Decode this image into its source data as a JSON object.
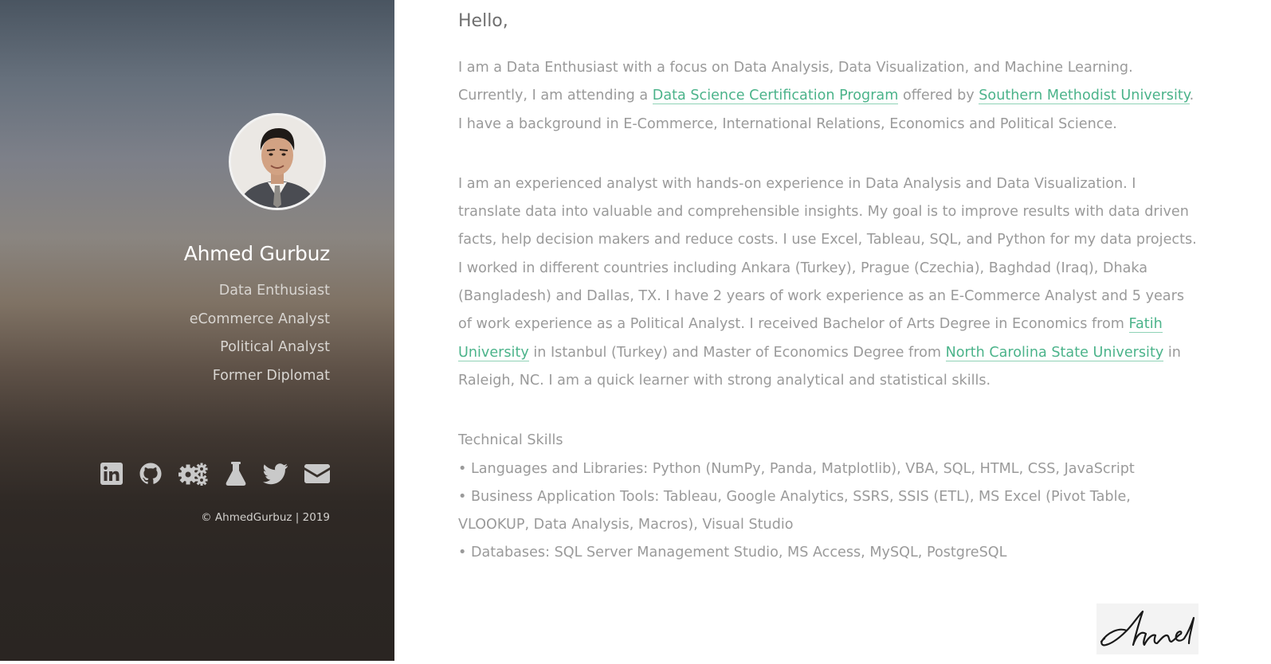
{
  "sidebar": {
    "name": "Ahmed Gurbuz",
    "roles": [
      "Data Enthusiast",
      "eCommerce Analyst",
      "Political Analyst",
      "Former Diplomat"
    ],
    "social": [
      {
        "icon": "linkedin-icon"
      },
      {
        "icon": "github-icon"
      },
      {
        "icon": "gears-icon"
      },
      {
        "icon": "flask-icon"
      },
      {
        "icon": "twitter-icon"
      },
      {
        "icon": "envelope-icon"
      }
    ],
    "copyright": "© AhmedGurbuz | 2019"
  },
  "main": {
    "greeting": "Hello,",
    "intro": {
      "line1": "I am a Data Enthusiast with a focus on Data Analysis, Data Visualization, and Machine Learning.",
      "line2_before": "Currently, I am attending a ",
      "link_program": "Data Science Certification Program",
      "line2_mid": " offered by ",
      "link_smu": "Southern Methodist University",
      "line2_after": ". I have a background in E-Commerce, International Relations, Economics and Political Science."
    },
    "experience": {
      "text_before": "I am an experienced analyst with hands-on experience in Data Analysis and Data Visualization. I translate data into valuable and comprehensible insights. My goal is to improve results with data driven facts, help decision makers and reduce costs. I use Excel, Tableau, SQL, and Python for my data projects. I worked in different countries including Ankara (Turkey), Prague (Czechia), Baghdad (Iraq), Dhaka (Bangladesh) and Dallas, TX. I have 2 years of work experience as an E-Commerce Analyst and 5 years of work experience as a Political Analyst. I received Bachelor of Arts Degree in Economics from ",
      "link_fatih": "Fatih University",
      "text_mid": " in Istanbul (Turkey) and Master of Economics Degree from ",
      "link_ncsu": "North Carolina State University",
      "text_after": " in Raleigh, NC. I am a quick learner with strong analytical and statistical skills."
    },
    "skills": {
      "heading": "Technical Skills",
      "items": [
        "• Languages and Libraries: Python (NumPy, Panda, Matplotlib), VBA, SQL, HTML, CSS, JavaScript",
        "• Business Application Tools: Tableau, Google Analytics, SSRS, SSIS (ETL), MS Excel (Pivot Table, VLOOKUP, Data Analysis, Macros), Visual Studio",
        "• Databases: SQL Server Management Studio, MS Access, MySQL, PostgreSQL"
      ]
    },
    "signature": "Ahmed"
  },
  "colors": {
    "link": "#4bb38a",
    "body_text": "#9a9a9a",
    "sidebar_top": "#4a5561",
    "sidebar_bottom": "#2a2522"
  }
}
